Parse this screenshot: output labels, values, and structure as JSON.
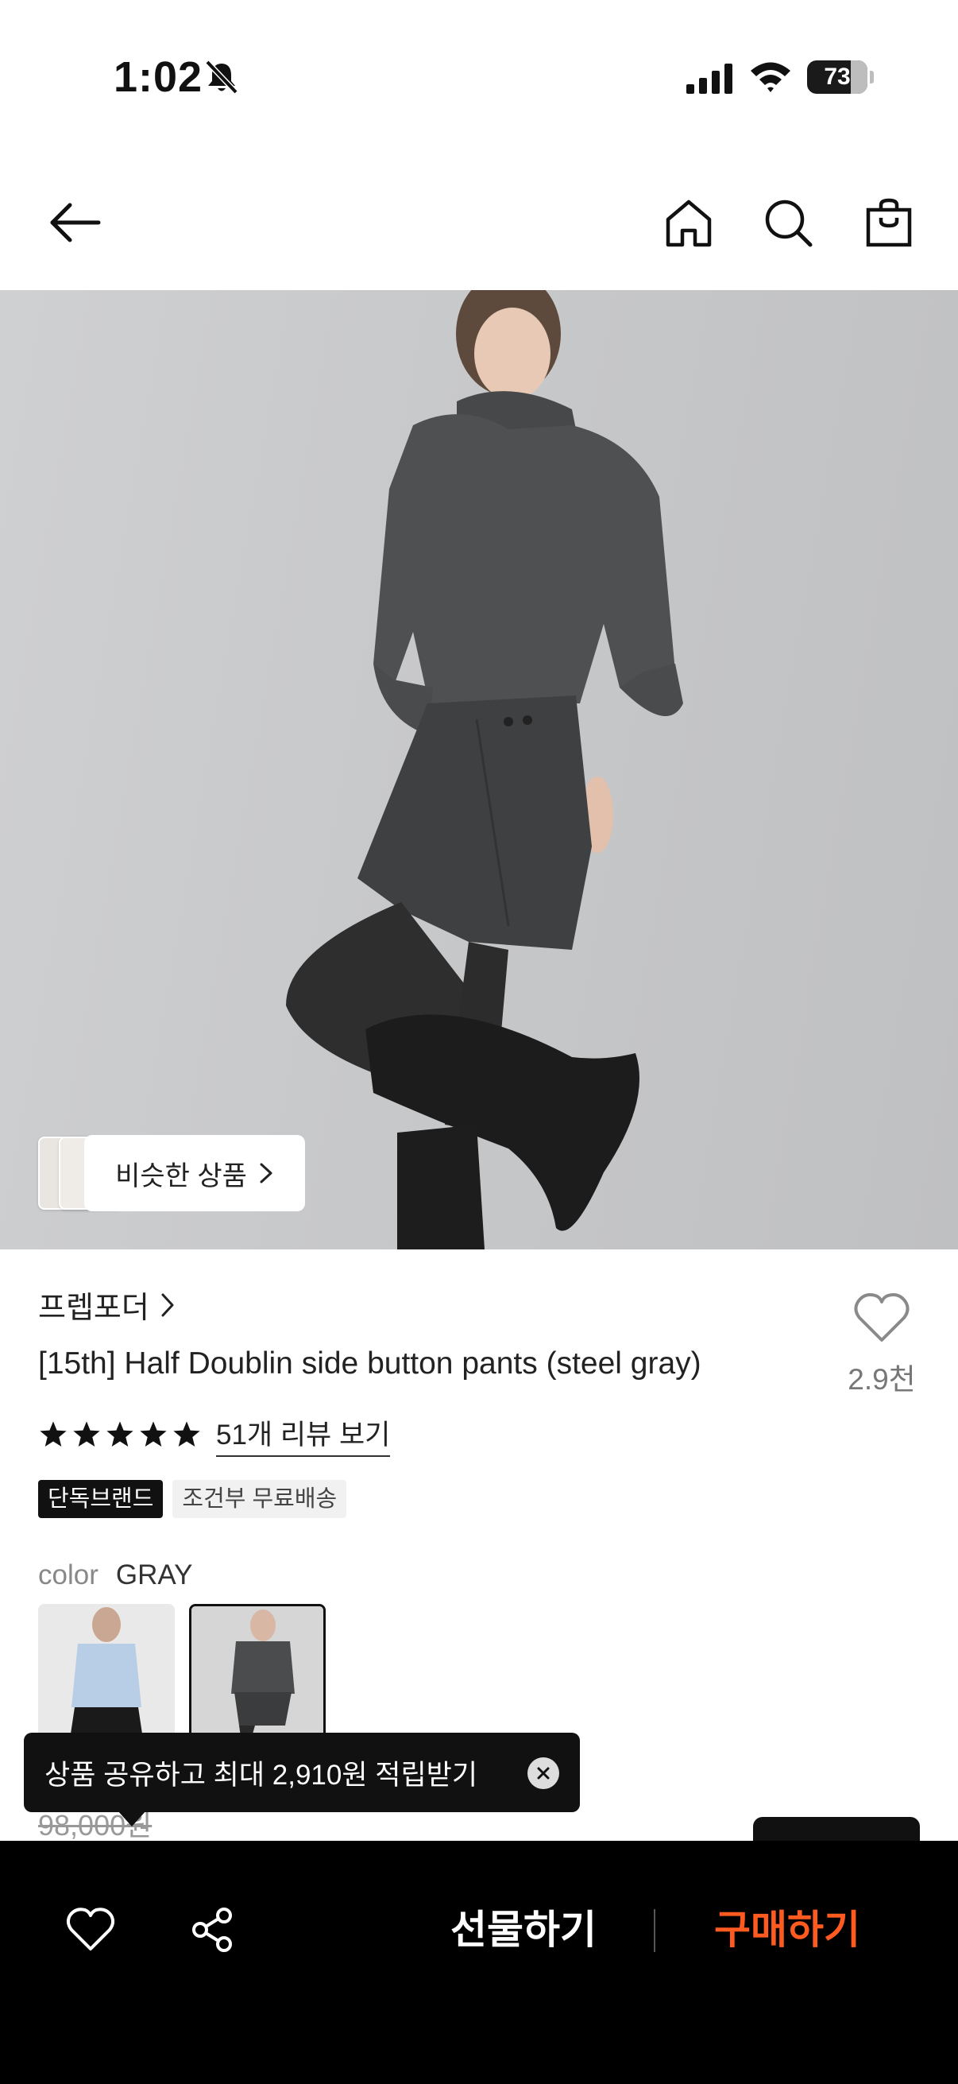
{
  "status_bar": {
    "time": "1:02",
    "battery": "73",
    "battery_level_percent": 73
  },
  "nav": {
    "back_icon": "arrow-left-icon",
    "home_icon": "home-icon",
    "search_icon": "search-icon",
    "cart_icon": "shopping-bag-icon"
  },
  "hero": {
    "similar_button_label": "비슷한 상품"
  },
  "product": {
    "brand": "프렙포더",
    "title": "[15th] Half Doublin side button pants (steel gray)",
    "likes": "2.9천",
    "rating_stars": 5,
    "review_link": "51개 리뷰 보기",
    "tags": [
      "단독브랜드",
      "조건부 무료배송"
    ],
    "color_label": "color",
    "color_value": "GRAY",
    "original_price": "98,000원"
  },
  "tooltip": {
    "text": "상품 공유하고 최대 2,910원 적립받기"
  },
  "bottom_bar": {
    "gift_label": "선물하기",
    "buy_label": "구매하기"
  },
  "colors": {
    "accent": "#ff5a1f",
    "bar_bg": "#000000",
    "tag_dark": "#111111",
    "tag_light": "#f1f1f1"
  }
}
